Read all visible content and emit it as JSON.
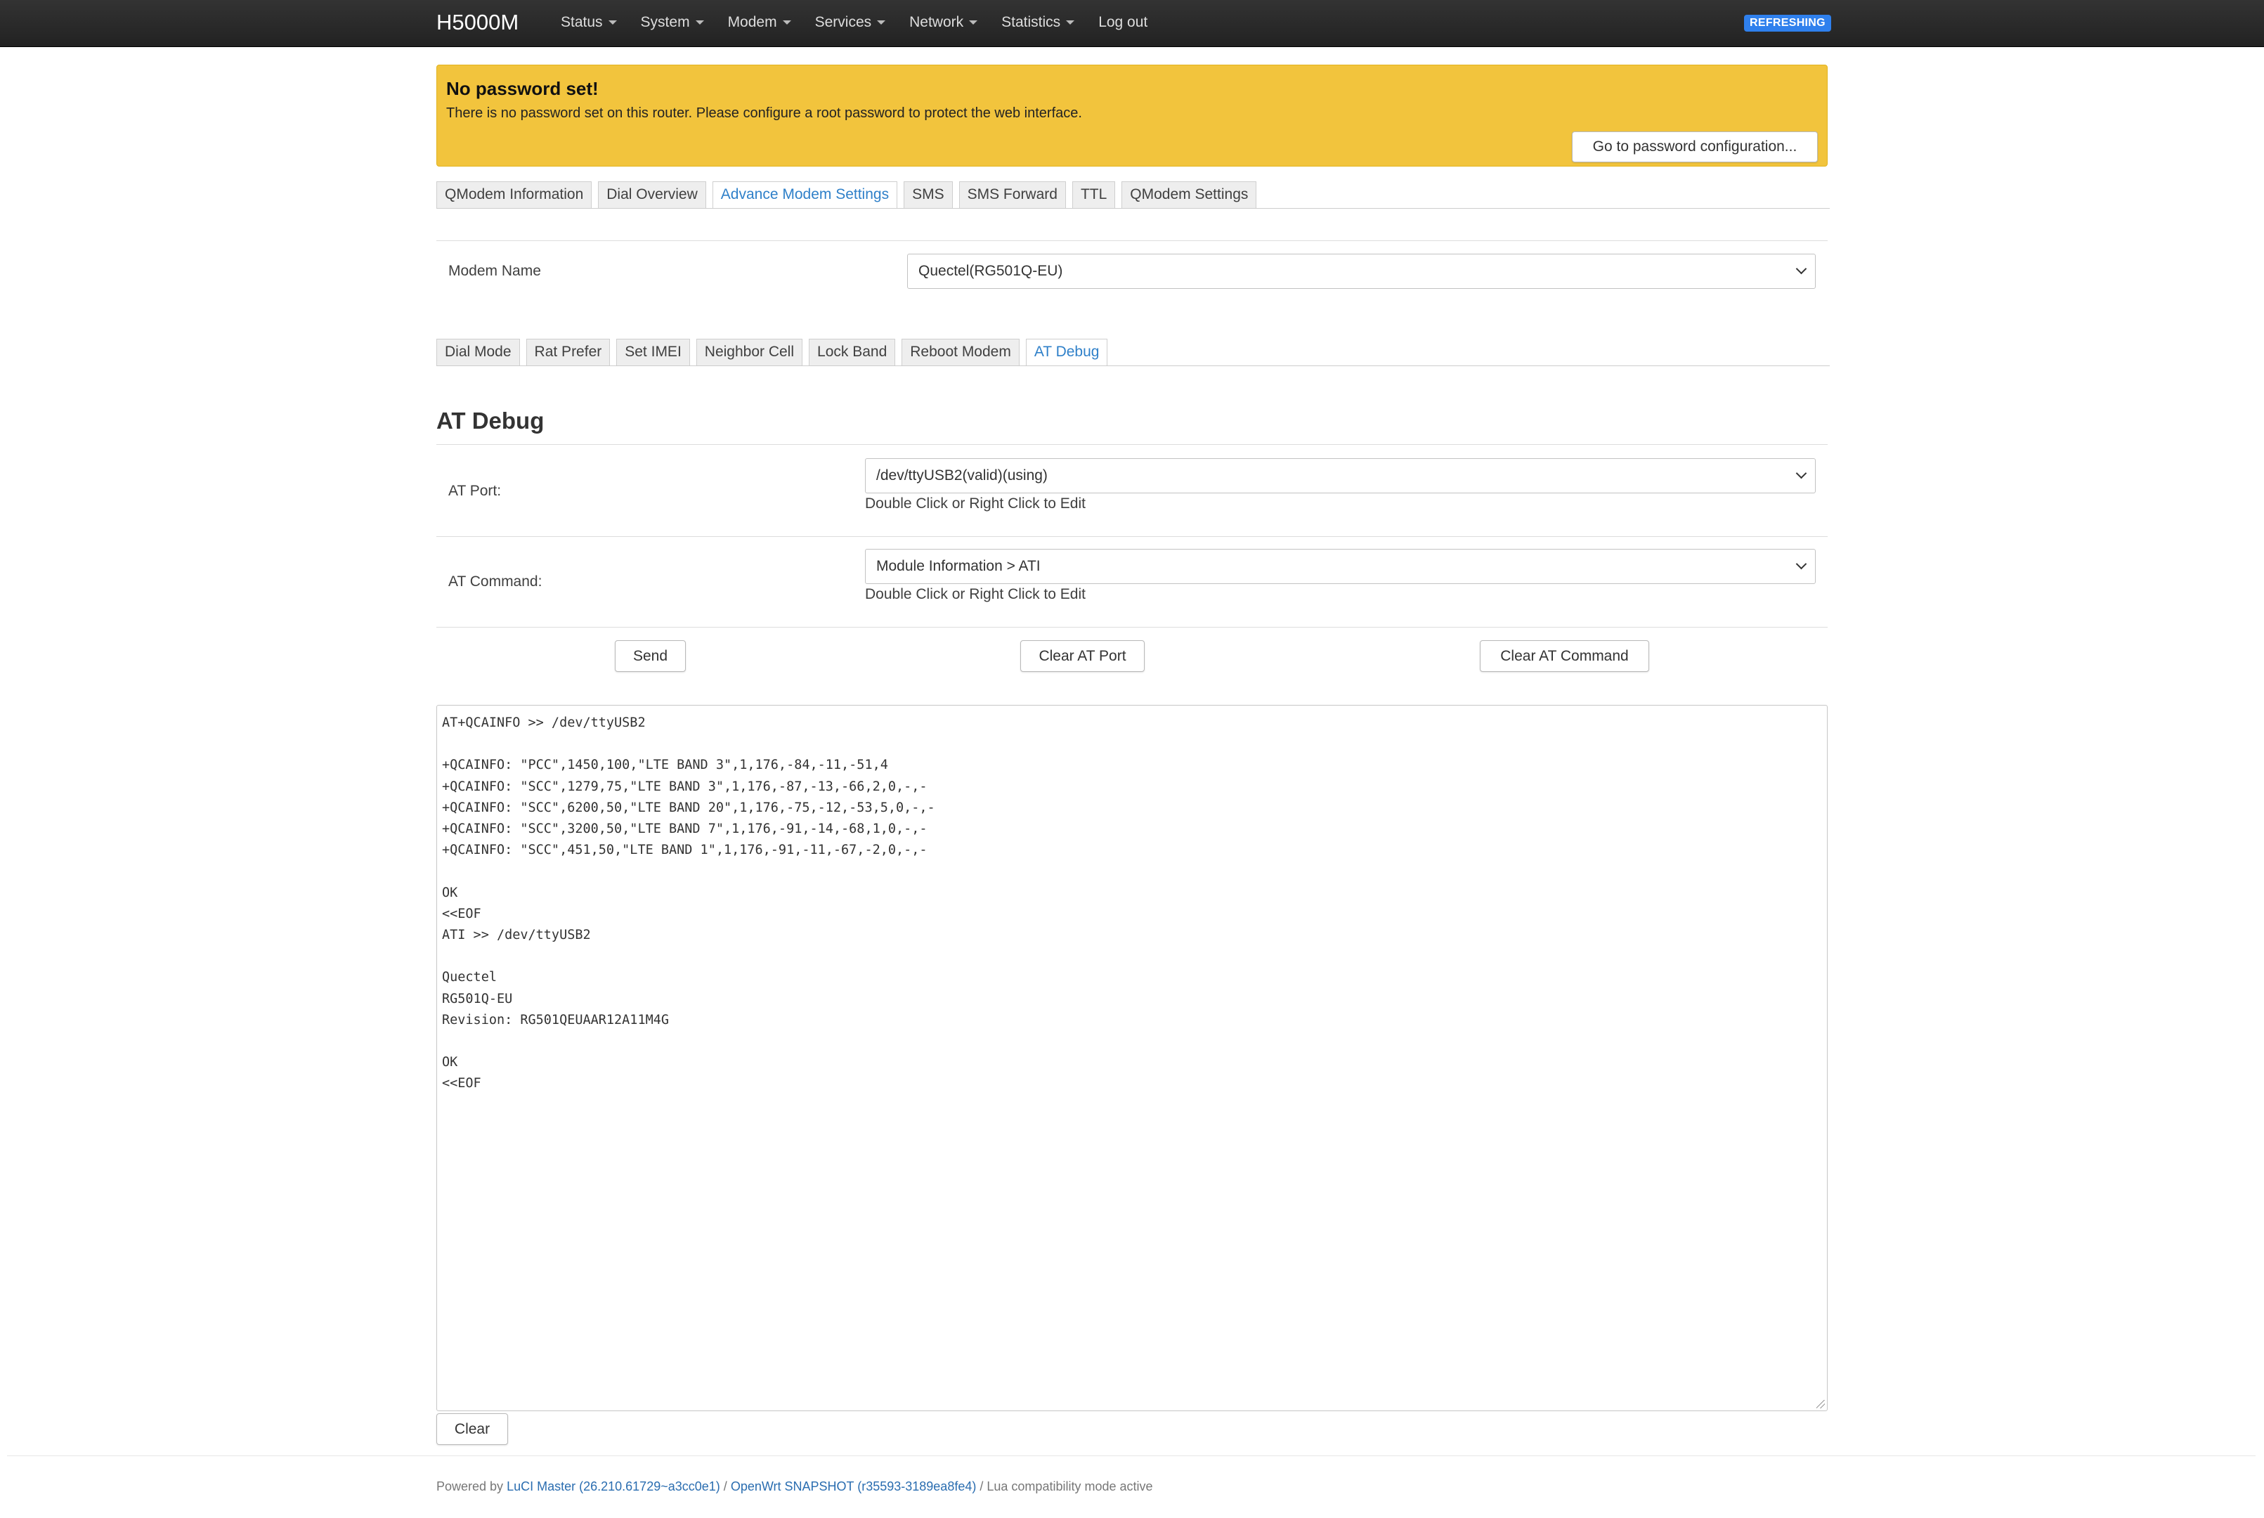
{
  "header": {
    "brand": "H5000M",
    "nav": [
      "Status",
      "System",
      "Modem",
      "Services",
      "Network",
      "Statistics"
    ],
    "logout": "Log out",
    "badge": "REFRESHING"
  },
  "alert": {
    "title": "No password set!",
    "text": "There is no password set on this router. Please configure a root password to protect the web interface.",
    "button": "Go to password configuration..."
  },
  "main_tabs": {
    "items": [
      "QModem Information",
      "Dial Overview",
      "Advance Modem Settings",
      "SMS",
      "SMS Forward",
      "TTL",
      "QModem Settings"
    ],
    "active": "Advance Modem Settings"
  },
  "modem": {
    "label": "Modem Name",
    "value": "Quectel(RG501Q-EU)"
  },
  "sub_tabs": {
    "items": [
      "Dial Mode",
      "Rat Prefer",
      "Set IMEI",
      "Neighbor Cell",
      "Lock Band",
      "Reboot Modem",
      "AT Debug"
    ],
    "active": "AT Debug"
  },
  "at_debug": {
    "title": "AT Debug",
    "port_label": "AT Port:",
    "port_value": "/dev/ttyUSB2(valid)(using)",
    "port_hint": "Double Click or Right Click to Edit",
    "command_label": "AT Command:",
    "command_value": "Module Information > ATI",
    "command_hint": "Double Click or Right Click to Edit",
    "send": "Send",
    "clear_port": "Clear AT Port",
    "clear_command": "Clear AT Command",
    "output": "AT+QCAINFO >> /dev/ttyUSB2\n\n+QCAINFO: \"PCC\",1450,100,\"LTE BAND 3\",1,176,-84,-11,-51,4\n+QCAINFO: \"SCC\",1279,75,\"LTE BAND 3\",1,176,-87,-13,-66,2,0,-,-\n+QCAINFO: \"SCC\",6200,50,\"LTE BAND 20\",1,176,-75,-12,-53,5,0,-,-\n+QCAINFO: \"SCC\",3200,50,\"LTE BAND 7\",1,176,-91,-14,-68,1,0,-,-\n+QCAINFO: \"SCC\",451,50,\"LTE BAND 1\",1,176,-91,-11,-67,-2,0,-,-\n\nOK\n<<EOF\nATI >> /dev/ttyUSB2\n\nQuectel\nRG501Q-EU\nRevision: RG501QEUAAR12A11M4G\n\nOK\n<<EOF",
    "clear": "Clear"
  },
  "footer": {
    "powered_by": "Powered by",
    "luci": "LuCI Master (26.210.61729~a3cc0e1)",
    "sep1": "/",
    "openwrt": "OpenWrt SNAPSHOT (r35593-3189ea8fe4)",
    "sep2": "/",
    "lua": "Lua compatibility mode active"
  },
  "colors": {
    "alert_bg": "#f2c43d",
    "badge_bg": "#2f80ed",
    "link": "#2f80c9"
  }
}
